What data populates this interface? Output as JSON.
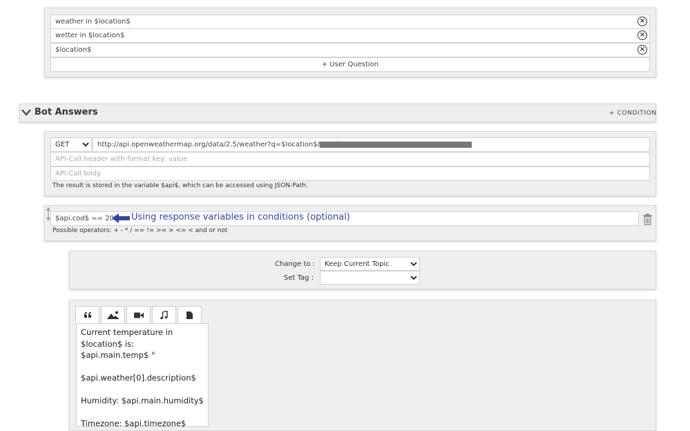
{
  "user_questions": {
    "items": [
      {
        "text": "weather in $location$"
      },
      {
        "text": "wetter in $location$"
      },
      {
        "text": "$location$"
      }
    ],
    "add_label": "+ User Question"
  },
  "bot_answers": {
    "title": "Bot Answers",
    "add_condition_label": "+ CONDITION"
  },
  "api_call": {
    "method": "GET",
    "method_options": [
      "GET"
    ],
    "url": "http://api.openweathermap.org/data/2.5/weather?q=$location$&appid=298",
    "header_placeholder": "API-Call header with format key: value",
    "body_placeholder": "API-Call body",
    "note": "The result is stored in the variable $api$, which can be accessed using JSON-Path."
  },
  "condition": {
    "value": "$api.cod$ == 200",
    "annotation": "Using response variables in conditions (optional)",
    "operators_note": "Possible operators: + - * / == != >= > <= < and or not"
  },
  "topic": {
    "change_to_label": "Change to :",
    "change_to_value": "Keep Current Topic",
    "set_tag_label": "Set Tag :",
    "set_tag_value": ""
  },
  "message": {
    "text": "Current temperature in $location$ is: $api.main.temp$ °\n\n$api.weather[0].description$\n\nHumidity: $api.main.humidity$\n\nTimezone: $api.timezone$"
  },
  "colors": {
    "annotation_blue": "#3344aa",
    "redaction_gray": "#777777"
  }
}
